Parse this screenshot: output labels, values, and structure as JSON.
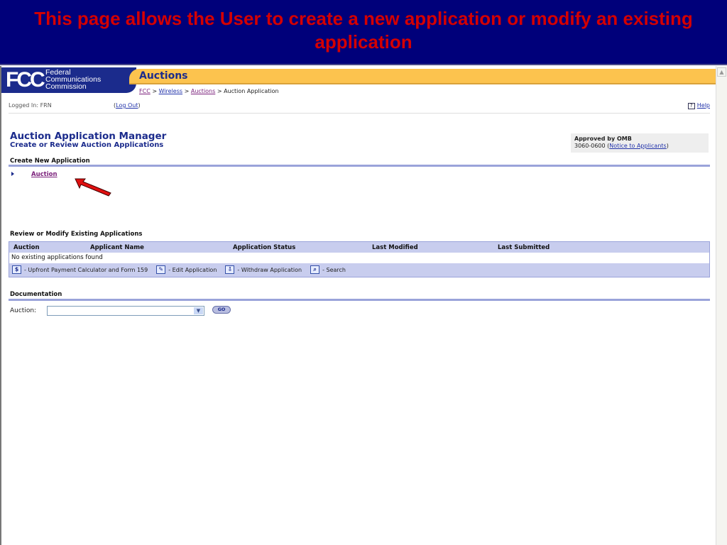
{
  "slide": {
    "title": "This page allows the User to create a new application or modify an existing application"
  },
  "header": {
    "logo_abbr": "FCC",
    "logo_line1": "Federal",
    "logo_line2": "Communications",
    "logo_line3": "Commission",
    "section": "Auctions"
  },
  "breadcrumb": {
    "items": [
      "FCC",
      "Wireless",
      "Auctions"
    ],
    "current": "Auction Application",
    "sep": ">"
  },
  "session": {
    "logged_in": "Logged In: FRN",
    "logout": "Log Out",
    "help": "Help"
  },
  "page": {
    "title": "Auction Application Manager",
    "subtitle": "Create or Review Auction Applications"
  },
  "omb": {
    "label": "Approved by OMB",
    "number": "3060-0600",
    "link": "Notice to Applicants"
  },
  "create": {
    "heading": "Create New Application",
    "link": "Auction"
  },
  "review": {
    "heading": "Review or Modify Existing Applications",
    "columns": [
      "Auction",
      "Applicant Name",
      "Application Status",
      "Last Modified",
      "Last Submitted"
    ],
    "empty": "No existing applications found",
    "legend": [
      "- Upfront Payment Calculator and Form 159",
      "- Edit Application",
      "- Withdraw Application",
      "- Search"
    ]
  },
  "documentation": {
    "heading": "Documentation",
    "label": "Auction:",
    "selected": "",
    "go": "GO"
  },
  "colors": {
    "navy": "#00007a",
    "title_red": "#d40000",
    "orange": "#fcc34e",
    "accent": "#9aa3da"
  }
}
